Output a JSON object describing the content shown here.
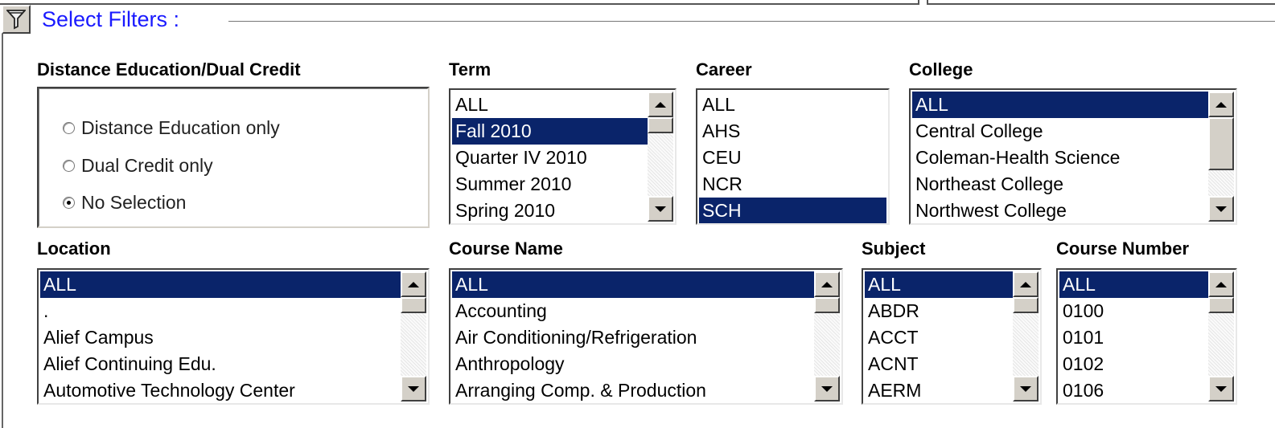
{
  "legend": "Select Filters :",
  "distance": {
    "label": "Distance Education/Dual Credit",
    "options": [
      "Distance Education only",
      "Dual Credit only",
      "No Selection"
    ],
    "selected": "No Selection"
  },
  "term": {
    "label": "Term",
    "items": [
      "ALL",
      "Fall 2010",
      "Quarter IV 2010",
      "Summer 2010",
      "Spring 2010"
    ],
    "selected": "Fall 2010"
  },
  "career": {
    "label": "Career",
    "items": [
      "ALL",
      "AHS",
      "CEU",
      "NCR",
      "SCH"
    ],
    "selected": "SCH"
  },
  "college": {
    "label": "College",
    "items": [
      "ALL",
      "Central College",
      "Coleman-Health Science",
      "Northeast College",
      "Northwest College"
    ],
    "selected": "ALL"
  },
  "location": {
    "label": "Location",
    "items": [
      "ALL",
      ".",
      "Alief Campus",
      "Alief Continuing Edu.",
      "Automotive Technology Center"
    ],
    "selected": "ALL"
  },
  "course_name": {
    "label": "Course Name",
    "items": [
      "ALL",
      "Accounting",
      "Air Conditioning/Refrigeration",
      "Anthropology",
      "Arranging Comp. & Production"
    ],
    "selected": "ALL"
  },
  "subject": {
    "label": "Subject",
    "items": [
      "ALL",
      "ABDR",
      "ACCT",
      "ACNT",
      "AERM"
    ],
    "selected": "ALL"
  },
  "course_number": {
    "label": "Course Number",
    "items": [
      "ALL",
      "0100",
      "0101",
      "0102",
      "0106"
    ],
    "selected": "ALL"
  },
  "colors": {
    "legend": "#1a1aff",
    "selection": "#0a246a"
  },
  "icons": {
    "filter_button": "funnel-icon",
    "scroll_up": "triangle-up",
    "scroll_down": "triangle-down"
  }
}
